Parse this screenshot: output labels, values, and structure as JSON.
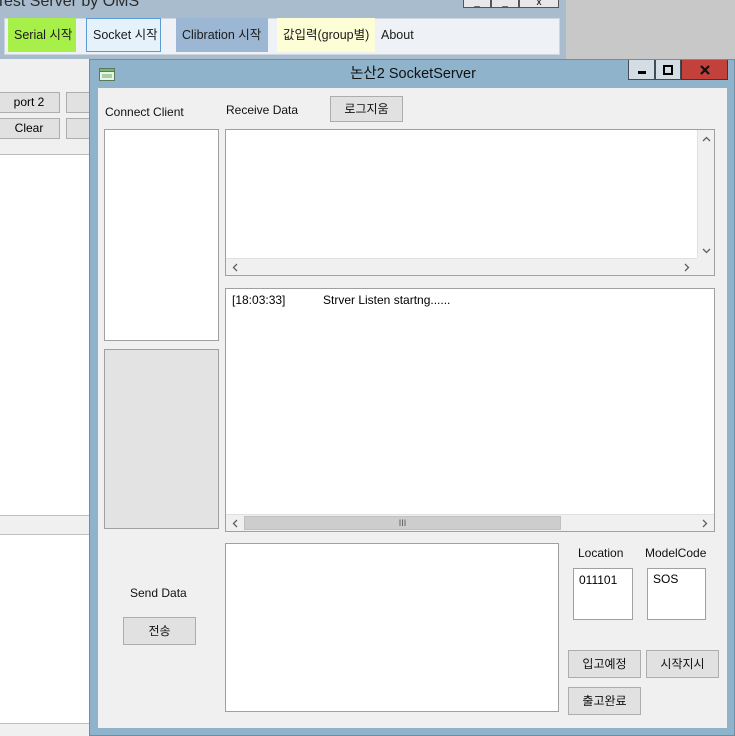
{
  "background_window": {
    "title": "Test Server by OMS",
    "controls": [
      "_",
      "_",
      "x"
    ],
    "menu": [
      {
        "label": "Serial 시작",
        "color": "#a7f04a"
      },
      {
        "label": "Socket 시작",
        "color": "#e6f2fb"
      },
      {
        "label": "Clibration 시작",
        "color": "#9bb7d3"
      },
      {
        "label": "값입력(group별)",
        "color": "#fdfdd6"
      },
      {
        "label": "About",
        "color": ""
      }
    ],
    "buttons": {
      "port2": "port 2",
      "clear": "Clear"
    }
  },
  "dialog": {
    "title": "논산2 SocketServer",
    "labels": {
      "connect_client": "Connect Client",
      "receive_data": "Receive Data",
      "send_data": "Send Data",
      "location": "Location",
      "model_code": "ModelCode"
    },
    "buttons": {
      "clear_log": "로그지움",
      "send": "전송",
      "inbound_scheduled": "입고예정",
      "start_instruction": "시작지시",
      "outbound_complete": "출고완료"
    },
    "log": [
      {
        "time": "[18:03:33]",
        "message": "Strver Listen startng......"
      }
    ],
    "fields": {
      "location_value": "011101",
      "model_code_value": "SOS"
    },
    "scroll_grip": "III"
  }
}
